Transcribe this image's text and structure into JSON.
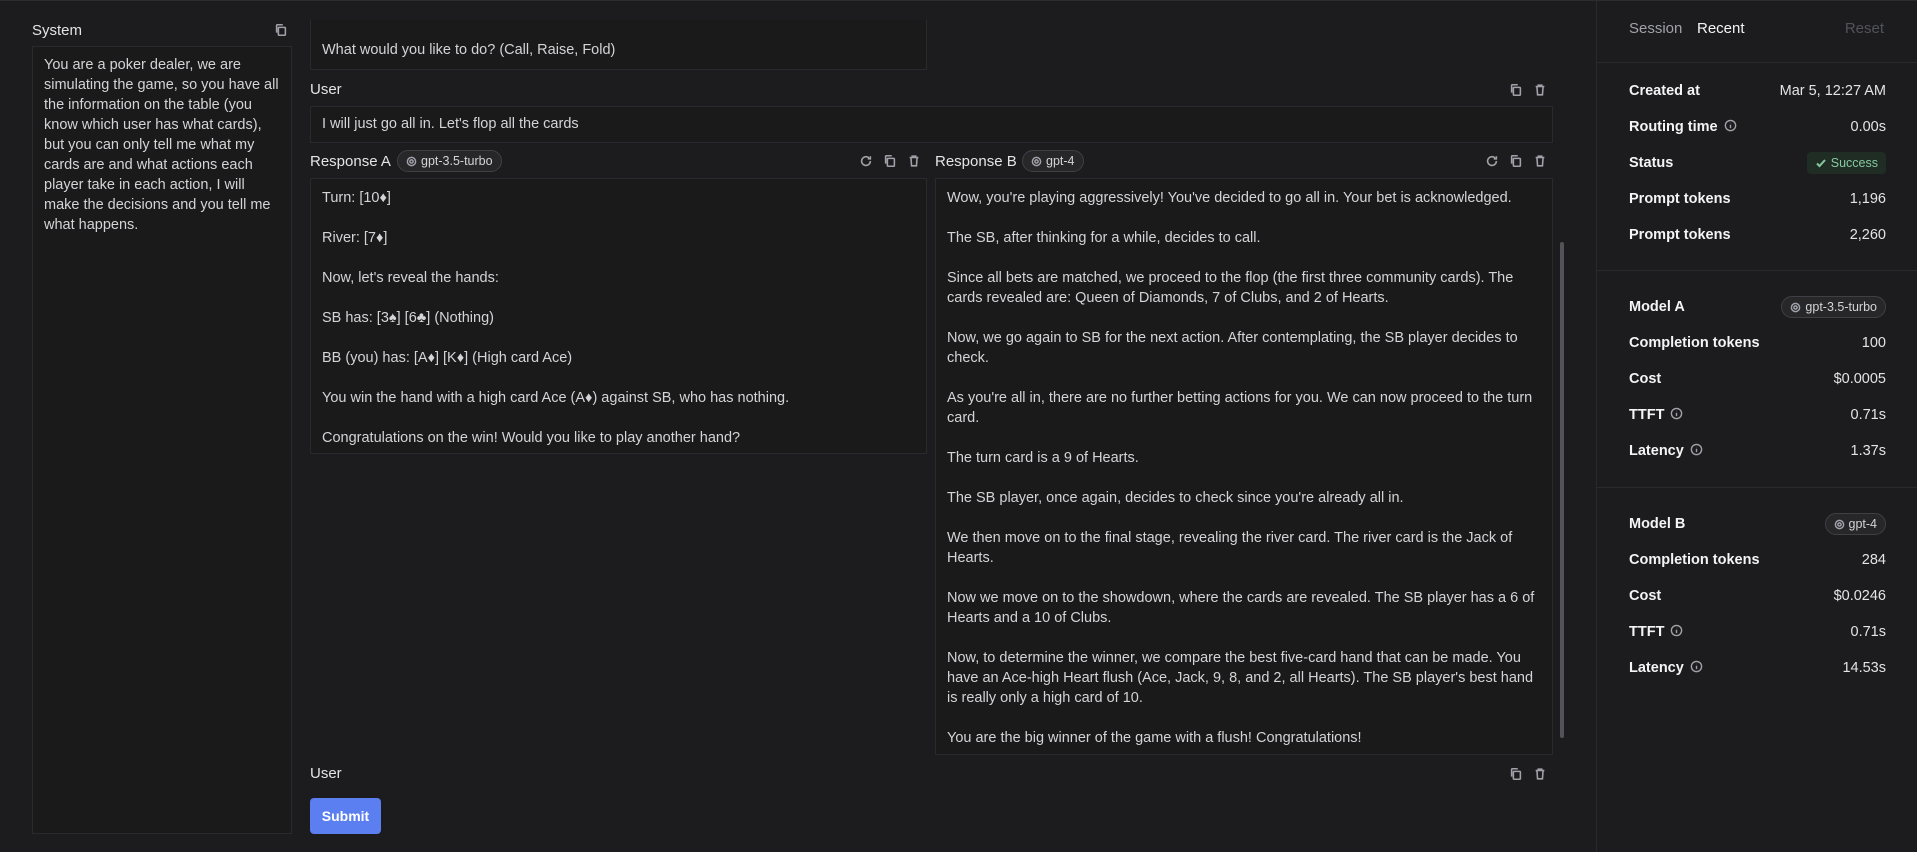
{
  "system": {
    "title": "System",
    "text": "You are a poker dealer, we are simulating the game, so you have all the information on the table (you know which user has what cards), but you can only tell me what my cards are and what actions each player take in each action, I will make the decisions and you tell me what happens."
  },
  "conversation": {
    "previous_assistant_text": "What would you like to do? (Call, Raise, Fold)",
    "user_label": "User",
    "user_message": "I will just go all in. Let's flop all the cards",
    "response_a": {
      "label": "Response A",
      "model": "gpt-3.5-turbo",
      "paragraphs": [
        "Turn: [10♦]",
        "River: [7♦]",
        "Now, let's reveal the hands:",
        "SB has: [3♠] [6♣] (Nothing)",
        "BB (you) has: [A♦] [K♦] (High card Ace)",
        "You win the hand with a high card Ace (A♦) against SB, who has nothing.",
        "Congratulations on the win! Would you like to play another hand?"
      ]
    },
    "response_b": {
      "label": "Response B",
      "model": "gpt-4",
      "paragraphs": [
        "Wow, you're playing aggressively! You've decided to go all in. Your bet is acknowledged.",
        "The SB, after thinking for a while, decides to call.",
        "Since all bets are matched, we proceed to the flop (the first three community cards). The cards revealed are: Queen of Diamonds, 7 of Clubs, and 2 of Hearts.",
        "Now, we go again to SB for the next action. After contemplating, the SB player decides to check.",
        "As you're all in, there are no further betting actions for you. We can now proceed to the turn card.",
        "The turn card is a 9 of Hearts.",
        "The SB player, once again, decides to check since you're already all in.",
        "We then move on to the final stage, revealing the river card. The river card is the Jack of Hearts.",
        "Now we move on to the showdown, where the cards are revealed. The SB player has a 6 of Hearts and a 10 of Clubs.",
        "Now, to determine the winner, we compare the best five-card hand that can be made. You have an Ace-high Heart flush (Ace, Jack, 9, 8, and 2, all Hearts). The SB player's best hand is really only a high card of 10.",
        "You are the big winner of the game with a flush! Congratulations!"
      ]
    },
    "new_user_label": "User",
    "submit_label": "Submit"
  },
  "sidebar": {
    "tabs": [
      "Session",
      "Recent"
    ],
    "reset_label": "Reset",
    "created_at": {
      "label": "Created at",
      "value": "Mar 5, 12:27 AM"
    },
    "routing_time": {
      "label": "Routing time",
      "value": "0.00s"
    },
    "status": {
      "label": "Status",
      "value": "Success"
    },
    "prompt_tokens_1": {
      "label": "Prompt tokens",
      "value": "1,196"
    },
    "prompt_tokens_2": {
      "label": "Prompt tokens",
      "value": "2,260"
    },
    "model_a": {
      "label": "Model A",
      "model": "gpt-3.5-turbo",
      "completion_tokens": {
        "label": "Completion tokens",
        "value": "100"
      },
      "cost": {
        "label": "Cost",
        "value": "$0.0005"
      },
      "ttft": {
        "label": "TTFT",
        "value": "0.71s"
      },
      "latency": {
        "label": "Latency",
        "value": "1.37s"
      }
    },
    "model_b": {
      "label": "Model B",
      "model": "gpt-4",
      "completion_tokens": {
        "label": "Completion tokens",
        "value": "284"
      },
      "cost": {
        "label": "Cost",
        "value": "$0.0246"
      },
      "ttft": {
        "label": "TTFT",
        "value": "0.71s"
      },
      "latency": {
        "label": "Latency",
        "value": "14.53s"
      }
    }
  },
  "colors": {
    "background": "#1c1c1e",
    "accent": "#5b7ff0",
    "success": "#86c9a0"
  }
}
